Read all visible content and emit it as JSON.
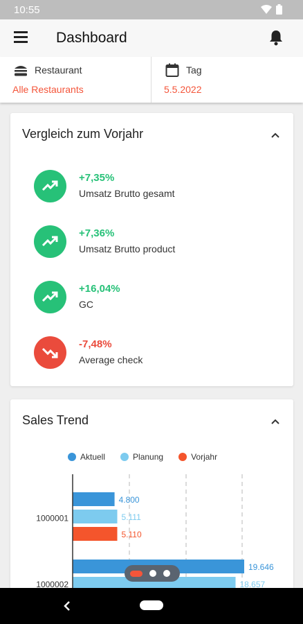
{
  "status_bar": {
    "time": "10:55"
  },
  "app_bar": {
    "title": "Dashboard"
  },
  "filters": {
    "restaurant": {
      "label": "Restaurant",
      "value": "Alle Restaurants"
    },
    "day": {
      "label": "Tag",
      "value": "5.5.2022"
    }
  },
  "comparison": {
    "title": "Vergleich zum Vorjahr",
    "items": [
      {
        "value": "+7,35%",
        "label": "Umsatz Brutto gesamt",
        "trend": "up"
      },
      {
        "value": "+7,36%",
        "label": "Umsatz Brutto product",
        "trend": "up"
      },
      {
        "value": "+16,04%",
        "label": "GC",
        "trend": "up"
      },
      {
        "value": "-7,48%",
        "label": "Average check",
        "trend": "down"
      }
    ]
  },
  "sales_trend": {
    "title": "Sales Trend"
  },
  "colors": {
    "accent": "#f4553a",
    "positive": "#27c178",
    "negative": "#ea4b3c",
    "series_aktuell": "#3a95d9",
    "series_planung": "#7dcbef",
    "series_vorjahr": "#f4552c"
  },
  "chart_data": {
    "type": "bar",
    "orientation": "horizontal",
    "categories": [
      "1000001",
      "1000002"
    ],
    "series": [
      {
        "name": "Aktuell",
        "values": [
          4800,
          19646
        ],
        "labels": [
          "4.800",
          "19.646"
        ]
      },
      {
        "name": "Planung",
        "values": [
          5111,
          18657
        ],
        "labels": [
          "5.111",
          "18.657"
        ]
      },
      {
        "name": "Vorjahr",
        "values": [
          5110,
          null
        ],
        "labels": [
          "5.110",
          ""
        ]
      }
    ],
    "legend_position": "top",
    "grid": true
  },
  "pager": {
    "pages": 3,
    "current": 1
  },
  "icons": {
    "menu": "menu-icon",
    "bell": "bell-icon",
    "restaurant": "burger-icon",
    "day": "calendar-icon",
    "trend_up": "trending-up-icon",
    "trend_down": "trending-down-icon",
    "collapse": "chevron-up-icon"
  }
}
